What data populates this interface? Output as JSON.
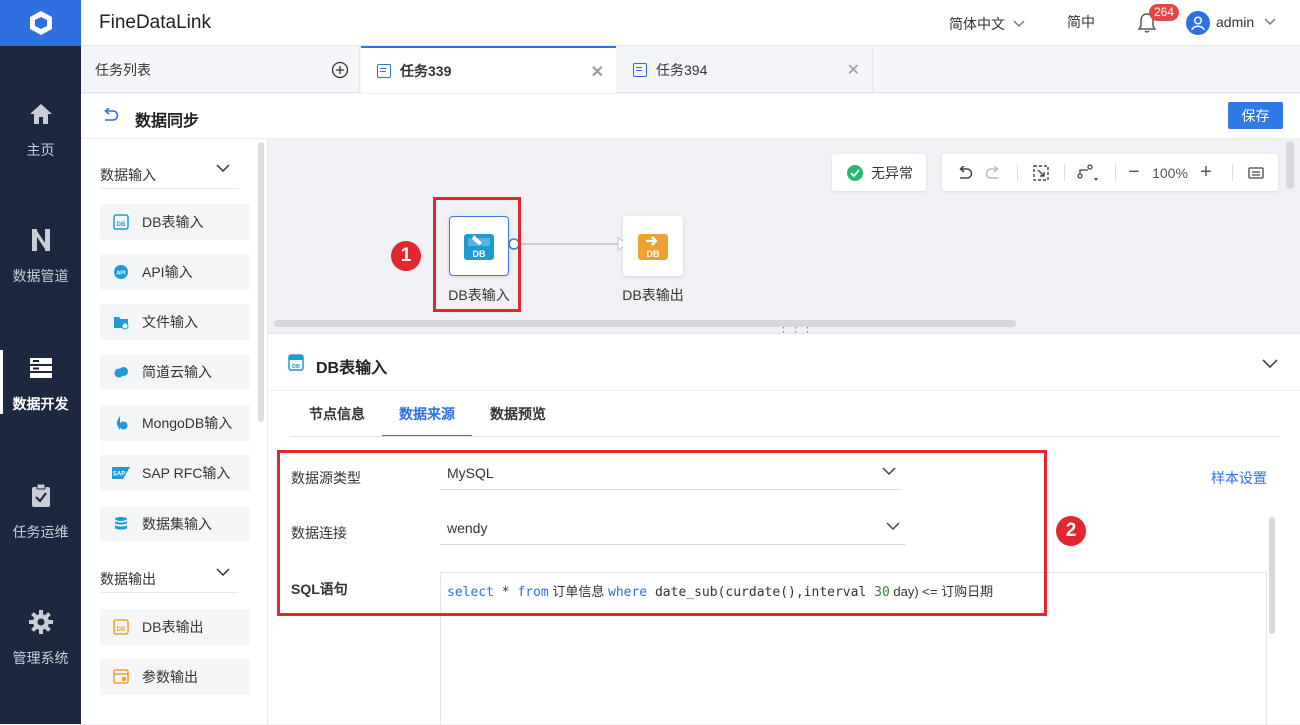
{
  "app": {
    "title": "FineDataLink"
  },
  "header": {
    "language": "简体中文",
    "locale_short": "简中",
    "notifications": "264",
    "user": "admin"
  },
  "nav": {
    "items": [
      {
        "label": "主页"
      },
      {
        "label": "数据管道"
      },
      {
        "label": "数据开发"
      },
      {
        "label": "任务运维"
      },
      {
        "label": "管理系统"
      }
    ],
    "active": "数据开发"
  },
  "tabs": {
    "list_label": "任务列表",
    "items": [
      {
        "label": "任务339"
      },
      {
        "label": "任务394"
      }
    ]
  },
  "page": {
    "title": "数据同步",
    "save_label": "保存"
  },
  "components": {
    "input_group": "数据输入",
    "inputs": [
      "DB表输入",
      "API输入",
      "文件输入",
      "简道云输入",
      "MongoDB输入",
      "SAP RFC输入",
      "数据集输入"
    ],
    "output_group": "数据输出",
    "outputs": [
      "DB表输出",
      "参数输出"
    ]
  },
  "canvas": {
    "status": "无异常",
    "zoom": "100%",
    "nodes": [
      {
        "label": "DB表输入",
        "icon_text": "DB"
      },
      {
        "label": "DB表输出",
        "icon_text": "DB"
      }
    ]
  },
  "panel": {
    "title": "DB表输入",
    "tabs": [
      "节点信息",
      "数据来源",
      "数据预览"
    ],
    "active_tab": "数据来源",
    "fields": {
      "source_type_label": "数据源类型",
      "source_type_value": "MySQL",
      "connection_label": "数据连接",
      "connection_value": "wendy",
      "sql_label": "SQL语句"
    },
    "sample_link": "样本设置",
    "sql": {
      "kw1": "select",
      "t1": " * ",
      "kw2": "from",
      "t2": " 订单信息 ",
      "kw3": "where",
      "t3": " date_sub(curdate(),interval ",
      "num": "30",
      "t4": " day) <= 订购日期"
    }
  },
  "annotations": {
    "marker1": "1",
    "marker2": "2"
  },
  "colors": {
    "accent": "#2f6fe0",
    "nav_bg": "#1e2740",
    "annotation_red": "#e3262f",
    "output_orange": "#f0a030"
  }
}
